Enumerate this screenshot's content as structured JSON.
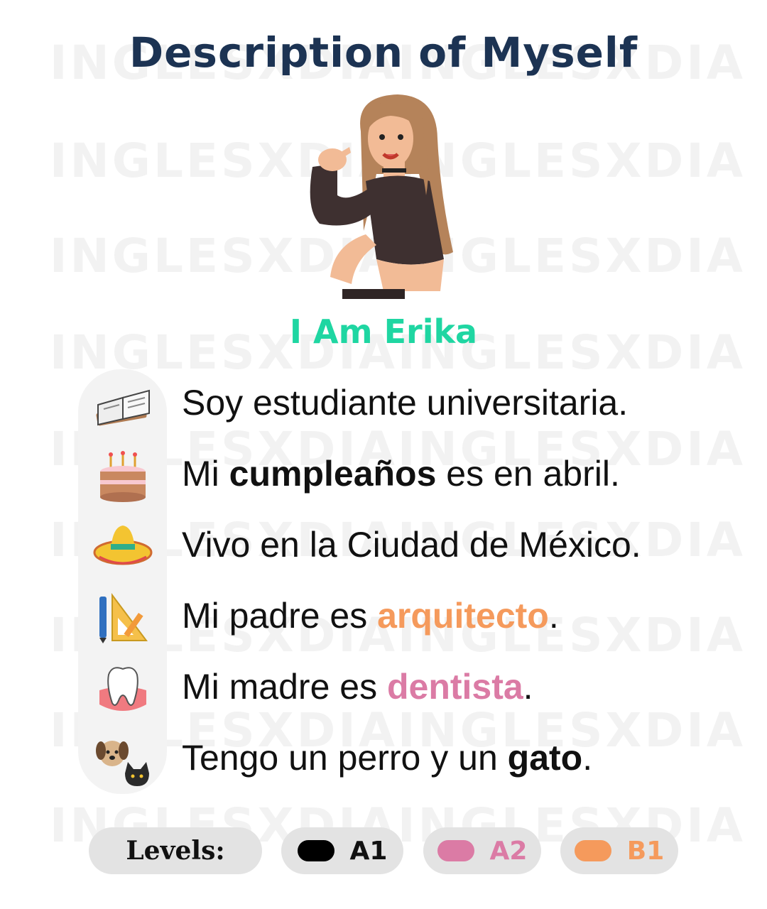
{
  "title": "Description of Myself",
  "name_line": "I Am Erika",
  "watermark": "INGLESXDIA",
  "sentences": [
    {
      "icon": "book-icon",
      "parts": [
        {
          "text": "Soy estudiante universitaria.",
          "style": "plain"
        }
      ]
    },
    {
      "icon": "cake-icon",
      "parts": [
        {
          "text": "Mi ",
          "style": "plain"
        },
        {
          "text": "cumpleaños",
          "style": "bold"
        },
        {
          "text": " es en abril.",
          "style": "plain"
        }
      ]
    },
    {
      "icon": "sombrero-icon",
      "parts": [
        {
          "text": "Vivo en la Ciudad de México.",
          "style": "plain"
        }
      ]
    },
    {
      "icon": "ruler-pen-icon",
      "parts": [
        {
          "text": "Mi padre es ",
          "style": "plain"
        },
        {
          "text": "arquitecto",
          "style": "orange"
        },
        {
          "text": ".",
          "style": "plain"
        }
      ]
    },
    {
      "icon": "tooth-icon",
      "parts": [
        {
          "text": "Mi madre es ",
          "style": "plain"
        },
        {
          "text": "dentista",
          "style": "pink"
        },
        {
          "text": ".",
          "style": "plain"
        }
      ]
    },
    {
      "icon": "dog-cat-icon",
      "parts": [
        {
          "text": "Tengo un perro y un ",
          "style": "plain"
        },
        {
          "text": "gato",
          "style": "bold"
        },
        {
          "text": ".",
          "style": "plain"
        }
      ]
    }
  ],
  "levels": {
    "label": "Levels:",
    "items": [
      {
        "code": "A1",
        "color": "#000000"
      },
      {
        "code": "A2",
        "color": "#db7ba5"
      },
      {
        "code": "B1",
        "color": "#f59a5c"
      }
    ]
  },
  "colors": {
    "title": "#1c3353",
    "name": "#1fd6a2",
    "orange": "#f59a5c",
    "pink": "#db7ba5"
  }
}
